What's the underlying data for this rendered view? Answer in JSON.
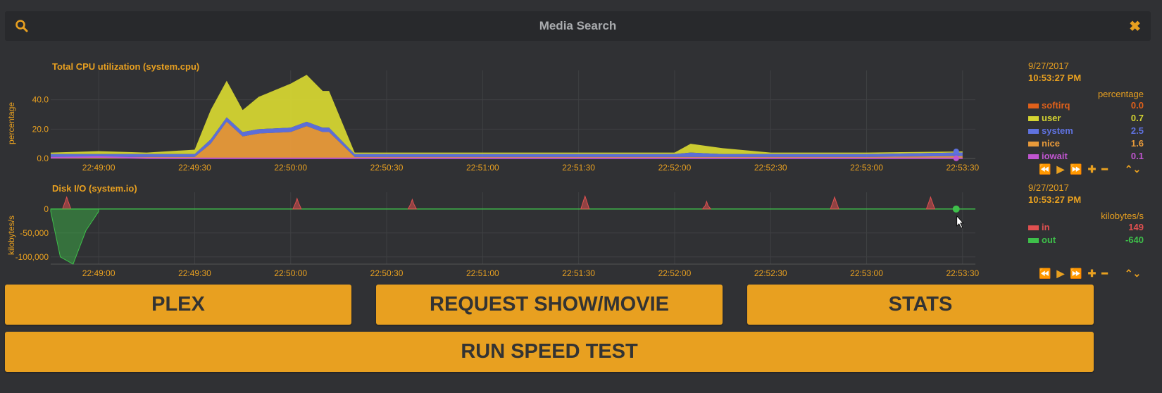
{
  "search": {
    "title": "Media Search"
  },
  "cpu_chart": {
    "title": "Total CPU utilization (system.cpu)",
    "ylabel": "percentage",
    "yticks": [
      "40.0",
      "20.0",
      "0.0"
    ],
    "xticks": [
      "22:49:00",
      "22:49:30",
      "22:50:00",
      "22:50:30",
      "22:51:00",
      "22:51:30",
      "22:52:00",
      "22:52:30",
      "22:53:00",
      "22:53:30"
    ],
    "legend": {
      "date": "9/27/2017",
      "time": "10:53:27 PM",
      "units": "percentage",
      "items": [
        {
          "label": "softirq",
          "value": "0.0",
          "color": "#e0601a"
        },
        {
          "label": "user",
          "value": "0.7",
          "color": "#d4d431"
        },
        {
          "label": "system",
          "value": "2.5",
          "color": "#5f72e0"
        },
        {
          "label": "nice",
          "value": "1.6",
          "color": "#e89a3a"
        },
        {
          "label": "iowait",
          "value": "0.1",
          "color": "#c055d0"
        }
      ]
    }
  },
  "io_chart": {
    "title": "Disk I/O (system.io)",
    "ylabel": "kilobytes/s",
    "yticks": [
      "0",
      "-50,000",
      "-100,000"
    ],
    "xticks": [
      "22:49:00",
      "22:49:30",
      "22:50:00",
      "22:50:30",
      "22:51:00",
      "22:51:30",
      "22:52:00",
      "22:52:30",
      "22:53:00",
      "22:53:30"
    ],
    "legend": {
      "date": "9/27/2017",
      "time": "10:53:27 PM",
      "units": "kilobytes/s",
      "items": [
        {
          "label": "in",
          "value": "149",
          "color": "#e05050"
        },
        {
          "label": "out",
          "value": "-640",
          "color": "#3ec04a"
        }
      ]
    }
  },
  "chart_data": [
    {
      "type": "area",
      "title": "Total CPU utilization (system.cpu)",
      "ylabel": "percentage",
      "ylim": [
        0,
        60
      ],
      "x": [
        "22:48:45",
        "22:49:00",
        "22:49:15",
        "22:49:30",
        "22:49:35",
        "22:49:40",
        "22:49:45",
        "22:49:50",
        "22:50:00",
        "22:50:05",
        "22:50:10",
        "22:50:12",
        "22:50:20",
        "22:50:30",
        "22:51:00",
        "22:51:30",
        "22:52:00",
        "22:52:05",
        "22:52:15",
        "22:52:30",
        "22:53:00",
        "22:53:30"
      ],
      "series": [
        {
          "name": "nice",
          "values": [
            1,
            1,
            1,
            1,
            10,
            25,
            15,
            17,
            18,
            22,
            18,
            18,
            1,
            1,
            1,
            1,
            1,
            1,
            1,
            1,
            1,
            1.6
          ]
        },
        {
          "name": "system",
          "values": [
            2,
            2,
            2,
            2,
            3,
            3,
            3,
            3,
            3,
            3,
            3,
            3,
            2,
            2,
            2,
            2,
            2,
            3,
            2,
            2,
            2,
            2.5
          ]
        },
        {
          "name": "user",
          "values": [
            1,
            2,
            1,
            3,
            20,
            25,
            15,
            22,
            30,
            32,
            25,
            25,
            1,
            1,
            1,
            1,
            1,
            6,
            4,
            1,
            1,
            0.7
          ]
        },
        {
          "name": "iowait",
          "values": [
            0.5,
            1,
            0.2,
            0.1,
            0.1,
            0.1,
            0.1,
            0.1,
            0.1,
            0.1,
            0.1,
            0.1,
            0.1,
            0.1,
            0.1,
            0.1,
            0.1,
            0.1,
            0.1,
            0.1,
            0.1,
            0.1
          ]
        }
      ]
    },
    {
      "type": "area",
      "title": "Disk I/O (system.io)",
      "ylabel": "kilobytes/s",
      "ylim": [
        -115000,
        35000
      ],
      "series": [
        {
          "name": "in",
          "spikes": [
            [
              "22:48:50",
              25000
            ],
            [
              "22:50:02",
              22000
            ],
            [
              "22:50:38",
              20000
            ],
            [
              "22:51:32",
              27000
            ],
            [
              "22:52:10",
              16000
            ],
            [
              "22:52:50",
              25000
            ],
            [
              "22:53:20",
              25000
            ]
          ],
          "last": 149
        },
        {
          "name": "out",
          "dip": [
            [
              "22:48:45",
              -5000
            ],
            [
              "22:48:48",
              -100000
            ],
            [
              "22:48:52",
              -115000
            ],
            [
              "22:48:56",
              -45000
            ],
            [
              "22:49:00",
              -5000
            ]
          ],
          "last": -640
        }
      ]
    }
  ],
  "buttons": {
    "plex": "PLEX",
    "request": "REQUEST SHOW/MOVIE",
    "stats": "STATS",
    "speedtest": "RUN SPEED TEST"
  },
  "colors": {
    "accent": "#e8a020",
    "background": "#303134",
    "grid": "#3c3d40",
    "io_in": "#e05050",
    "io_out": "#3ec04a"
  },
  "icons": {
    "search": "search-icon",
    "close": "close-icon",
    "rewind": "rewind-icon",
    "play": "play-icon",
    "forward": "forward-icon",
    "zoom_in": "plus-icon",
    "zoom_out": "minus-icon",
    "resize": "resize-icon"
  }
}
